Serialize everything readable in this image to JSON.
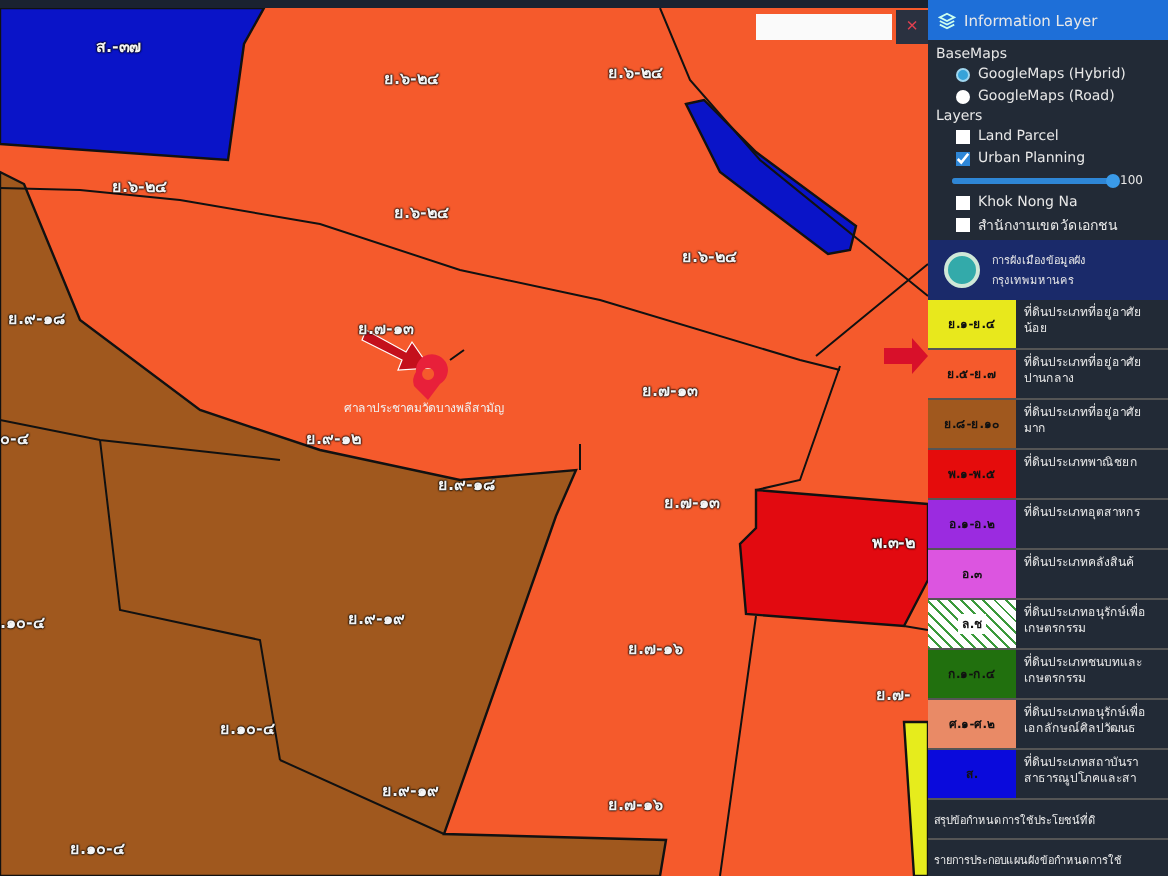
{
  "map": {
    "search_button": "×",
    "parcels": [
      {
        "kind": "institution"
      },
      {
        "kind": "institution"
      },
      {
        "kind": "dense"
      },
      {
        "kind": "commercial"
      },
      {
        "kind": "low"
      }
    ],
    "labels": [
      "ส.-๓๗",
      "ย.๖-๒๔",
      "ย.๖-๒๔",
      "ย.๖-๒๔",
      "ย.๖-๒๔",
      "ย.๖-๒๔",
      "ย.๙-๑๘",
      "ย.๗-๑๓",
      "ย.๗-๑๓",
      "๐-๔",
      "ย.๙-๑๒",
      "ย.๙-๑๘",
      "ย.๗-๑๓",
      "พ.๓-๒",
      ".๑๐-๔",
      "ย.๙-๑๙",
      "ย.๗-๑๖",
      "ย.๑๐-๔",
      "ย.๙-๑๙",
      "ย.๗-๑๖",
      "ย.๑๐-๔",
      "ย.๗-"
    ],
    "marker": {
      "caption": "ศาลาประชาคมวัดบางพลีสามัญ"
    }
  },
  "panel": {
    "title": "Information Layer",
    "basemaps_heading": "BaseMaps",
    "basemaps": [
      {
        "label": "GoogleMaps (Hybrid)",
        "selected": true
      },
      {
        "label": "GoogleMaps (Road)",
        "selected": false
      }
    ],
    "layers_heading": "Layers",
    "layers": [
      {
        "kind": "check",
        "label": "Land Parcel",
        "checked": false
      },
      {
        "kind": "check",
        "label": "Urban Planning",
        "checked": true
      },
      {
        "kind": "slider",
        "level": 1,
        "reading": "100"
      },
      {
        "kind": "check",
        "label": "Khok Nong Na",
        "checked": false
      },
      {
        "kind": "check",
        "label": "สำนักงานเขตวัดเอกชน",
        "checked": false
      }
    ],
    "org": [
      "การผังเมืองข้อมูลผัง",
      "กรุงเทพมหานคร"
    ],
    "legend": [
      {
        "code": "ย.๑-ย.๔",
        "color": "#e8e81c",
        "hatched": false,
        "lines": [
          "ที่ดินประเภทที่อยู่อาศัย",
          "น้อย"
        ]
      },
      {
        "code": "ย.๕-ย.๗",
        "color": "#f55a2c",
        "hatched": false,
        "lines": [
          "ที่ดินประเภทที่อยู่อาศัย",
          "ปานกลาง"
        ]
      },
      {
        "code": "ย.๘-ย.๑๐",
        "color": "#a0581e",
        "hatched": false,
        "lines": [
          "ที่ดินประเภทที่อยู่อาศัย",
          "มาก"
        ]
      },
      {
        "code": "พ.๑-พ.๕",
        "color": "#e50c0c",
        "hatched": false,
        "lines": [
          "ที่ดินประเภทพาณิชยก"
        ]
      },
      {
        "code": "อ.๑-อ.๒",
        "color": "#9b2be0",
        "hatched": false,
        "lines": [
          "ที่ดินประเภทอุตสาหกร"
        ]
      },
      {
        "code": "อ.๓",
        "color": "#dc55e0",
        "hatched": false,
        "lines": [
          "ที่ดินประเภทคลังสินค้"
        ]
      },
      {
        "code": "ล.ช",
        "color": "#3c9a3c",
        "hatched": true,
        "lines": [
          "ที่ดินประเภทอนุรักษ์เพื่อ",
          "เกษตรกรรม"
        ]
      },
      {
        "code": "ก.๑-ก.๔",
        "color": "#21700e",
        "hatched": false,
        "lines": [
          "ที่ดินประเภทชนบทและ",
          "เกษตรกรรม"
        ]
      },
      {
        "code": "ศ.๑-ศ.๒",
        "color": "#e98a66",
        "hatched": false,
        "lines": [
          "ที่ดินประเภทอนุรักษ์เพื่อ",
          "เอกลักษณ์ศิลปวัฒนธ"
        ]
      },
      {
        "code": "ส.",
        "color": "#0a0adc",
        "hatched": false,
        "lines": [
          "ที่ดินประเภทสถาบันรา",
          "สาธารณูปโภคและสา"
        ]
      }
    ],
    "footer": [
      "สรุปข้อกำหนดการใช้ประโยชน์ที่ดิ",
      "รายการประกอบแผนผังข้อกำหนดการใช้"
    ]
  }
}
